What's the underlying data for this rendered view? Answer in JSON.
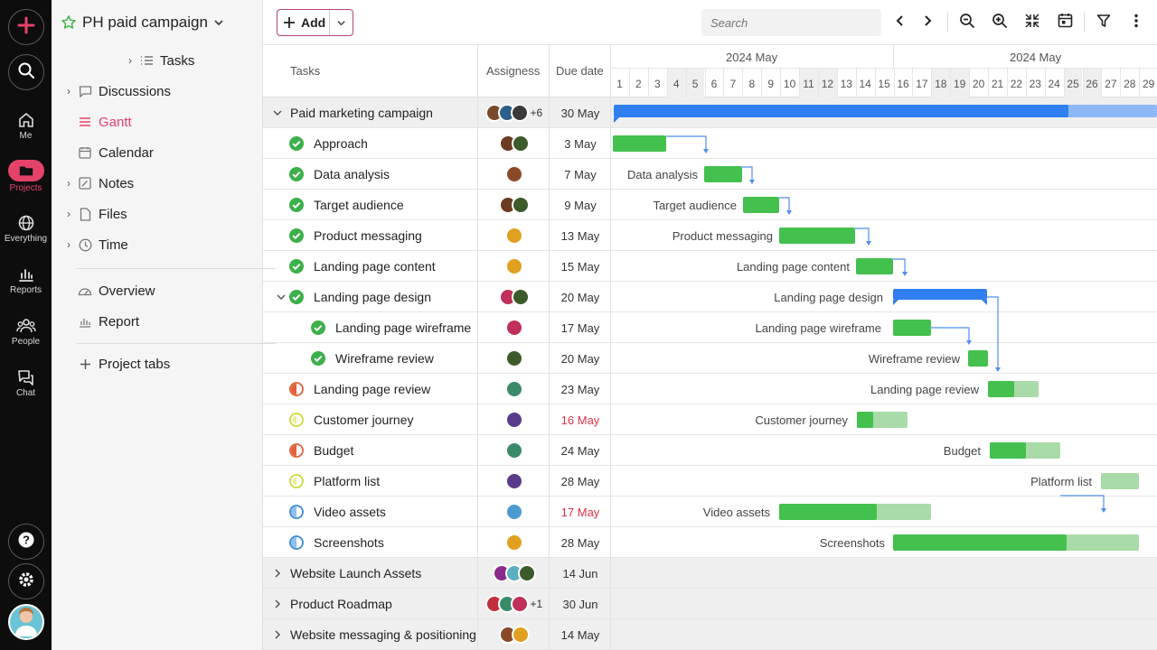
{
  "rail": {
    "items": [
      {
        "label": "Me"
      },
      {
        "label": "Projects"
      },
      {
        "label": "Everything"
      },
      {
        "label": "Reports"
      },
      {
        "label": "People"
      },
      {
        "label": "Chat"
      }
    ],
    "accent": "#e5426a"
  },
  "sidebar": {
    "project_title": "PH paid campaign",
    "items": [
      {
        "label": "Tasks"
      },
      {
        "label": "Discussions"
      },
      {
        "label": "Gantt"
      },
      {
        "label": "Calendar"
      },
      {
        "label": "Notes"
      },
      {
        "label": "Files"
      },
      {
        "label": "Time"
      },
      {
        "label": "Overview"
      },
      {
        "label": "Report"
      },
      {
        "label": "Project tabs"
      }
    ]
  },
  "toolbar": {
    "add_label": "Add",
    "search_placeholder": "Search"
  },
  "table": {
    "headers": {
      "tasks": "Tasks",
      "assignees": "Assigness",
      "due": "Due date"
    },
    "rows": [
      {
        "name": "Paid marketing campaign",
        "due": "30 May",
        "more": "+6"
      },
      {
        "name": "Approach",
        "due": "3 May"
      },
      {
        "name": "Data analysis",
        "due": "7 May"
      },
      {
        "name": "Target audience",
        "due": "9 May"
      },
      {
        "name": "Product messaging",
        "due": "13 May"
      },
      {
        "name": "Landing page content",
        "due": "15 May"
      },
      {
        "name": "Landing page design",
        "due": "20 May"
      },
      {
        "name": "Landing page wireframe",
        "due": "17 May"
      },
      {
        "name": "Wireframe review",
        "due": "20 May"
      },
      {
        "name": "Landing page review",
        "due": "23 May"
      },
      {
        "name": "Customer journey",
        "due": "16 May"
      },
      {
        "name": "Budget",
        "due": "24 May"
      },
      {
        "name": "Platform list",
        "due": "28 May"
      },
      {
        "name": "Video assets",
        "due": "17 May"
      },
      {
        "name": "Screenshots",
        "due": "28 May"
      },
      {
        "name": "Website Launch Assets",
        "due": "14 Jun"
      },
      {
        "name": "Product Roadmap",
        "due": "30 Jun",
        "more": "+1"
      },
      {
        "name": "Website messaging & positioning",
        "due": "14 May"
      }
    ]
  },
  "gantt": {
    "month_left": "2024 May",
    "month_right": "2024 May",
    "days": [
      "1",
      "2",
      "3",
      "4",
      "5",
      "6",
      "7",
      "8",
      "9",
      "10",
      "11",
      "12",
      "13",
      "14",
      "15",
      "16",
      "17",
      "18",
      "19",
      "20",
      "21",
      "22",
      "23",
      "24",
      "25",
      "26",
      "27",
      "28",
      "29"
    ],
    "labels": {
      "data_analysis": "Data analysis",
      "target_audience": "Target audience",
      "product_messaging": "Product messaging",
      "landing_page_content": "Landing page content",
      "landing_page_design": "Landing page design",
      "landing_page_wireframe": "Landing page wireframe",
      "wireframe_review": "Wireframe review",
      "landing_page_review": "Landing page review",
      "customer_journey": "Customer journey",
      "budget": "Budget",
      "platform_list": "Platform list",
      "video_assets": "Video assets",
      "screenshots": "Screenshots"
    },
    "colors": {
      "green": "#44c04e",
      "green_light": "#a9dba8",
      "blue": "#2f7ff0",
      "blue_light": "#8cb9f5"
    }
  }
}
